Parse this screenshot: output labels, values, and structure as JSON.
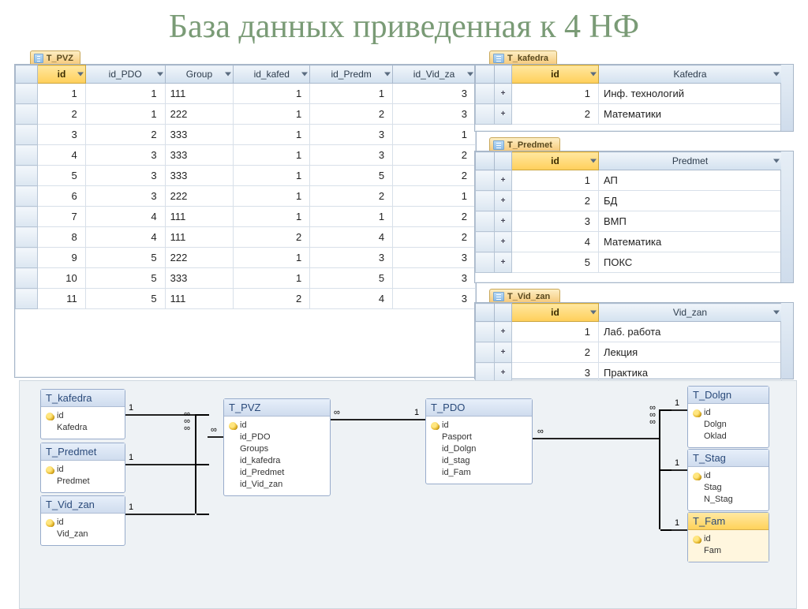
{
  "title": "База данных приведенная к 4 НФ",
  "tables": {
    "t_pvz": {
      "tab": "T_PVZ",
      "columns": [
        "id",
        "id_PDO",
        "Group",
        "id_kafed",
        "id_Predm",
        "id_Vid_za"
      ],
      "rows": [
        {
          "id": 1,
          "id_PDO": 1,
          "Group": "111",
          "id_kafed": 1,
          "id_Predm": 1,
          "id_Vid_za": 3
        },
        {
          "id": 2,
          "id_PDO": 1,
          "Group": "222",
          "id_kafed": 1,
          "id_Predm": 2,
          "id_Vid_za": 3
        },
        {
          "id": 3,
          "id_PDO": 2,
          "Group": "333",
          "id_kafed": 1,
          "id_Predm": 3,
          "id_Vid_za": 1
        },
        {
          "id": 4,
          "id_PDO": 3,
          "Group": "333",
          "id_kafed": 1,
          "id_Predm": 3,
          "id_Vid_za": 2
        },
        {
          "id": 5,
          "id_PDO": 3,
          "Group": "333",
          "id_kafed": 1,
          "id_Predm": 5,
          "id_Vid_za": 2
        },
        {
          "id": 6,
          "id_PDO": 3,
          "Group": "222",
          "id_kafed": 1,
          "id_Predm": 2,
          "id_Vid_za": 1
        },
        {
          "id": 7,
          "id_PDO": 4,
          "Group": "111",
          "id_kafed": 1,
          "id_Predm": 1,
          "id_Vid_za": 2
        },
        {
          "id": 8,
          "id_PDO": 4,
          "Group": "111",
          "id_kafed": 2,
          "id_Predm": 4,
          "id_Vid_za": 2
        },
        {
          "id": 9,
          "id_PDO": 5,
          "Group": "222",
          "id_kafed": 1,
          "id_Predm": 3,
          "id_Vid_za": 3
        },
        {
          "id": 10,
          "id_PDO": 5,
          "Group": "333",
          "id_kafed": 1,
          "id_Predm": 5,
          "id_Vid_za": 3
        },
        {
          "id": 11,
          "id_PDO": 5,
          "Group": "111",
          "id_kafed": 2,
          "id_Predm": 4,
          "id_Vid_za": 3
        }
      ]
    },
    "t_kafedra": {
      "tab": "T_kafedra",
      "columns": [
        "id",
        "Kafedra"
      ],
      "rows": [
        {
          "id": 1,
          "Kafedra": "Инф. технологий"
        },
        {
          "id": 2,
          "Kafedra": "Математики"
        }
      ]
    },
    "t_predmet": {
      "tab": "T_Predmet",
      "columns": [
        "id",
        "Predmet"
      ],
      "rows": [
        {
          "id": 1,
          "Predmet": "АП"
        },
        {
          "id": 2,
          "Predmet": "БД"
        },
        {
          "id": 3,
          "Predmet": "ВМП"
        },
        {
          "id": 4,
          "Predmet": "Математика"
        },
        {
          "id": 5,
          "Predmet": "ПОКС"
        }
      ]
    },
    "t_vid_zan": {
      "tab": "T_Vid_zan",
      "columns": [
        "id",
        "Vid_zan"
      ],
      "rows": [
        {
          "id": 1,
          "Vid_zan": "Лаб. работа"
        },
        {
          "id": 2,
          "Vid_zan": "Лекция"
        },
        {
          "id": 3,
          "Vid_zan": "Практика"
        }
      ]
    }
  },
  "diagram": {
    "boxes": {
      "t_kafedra": {
        "title": "T_kafedra",
        "fields": [
          {
            "n": "id",
            "pk": true
          },
          {
            "n": "Kafedra"
          }
        ]
      },
      "t_predmet": {
        "title": "T_Predmet",
        "fields": [
          {
            "n": "id",
            "pk": true
          },
          {
            "n": "Predmet"
          }
        ]
      },
      "t_vid_zan": {
        "title": "T_Vid_zan",
        "fields": [
          {
            "n": "id",
            "pk": true
          },
          {
            "n": "Vid_zan"
          }
        ]
      },
      "t_pvz": {
        "title": "T_PVZ",
        "fields": [
          {
            "n": "id",
            "pk": true
          },
          {
            "n": "id_PDO"
          },
          {
            "n": "Groups"
          },
          {
            "n": "id_kafedra"
          },
          {
            "n": "id_Predmet"
          },
          {
            "n": "id_Vid_zan"
          }
        ]
      },
      "t_pdo": {
        "title": "T_PDO",
        "fields": [
          {
            "n": "id",
            "pk": true
          },
          {
            "n": "Pasport"
          },
          {
            "n": "id_Dolgn"
          },
          {
            "n": "id_stag"
          },
          {
            "n": "id_Fam"
          }
        ]
      },
      "t_dolgn": {
        "title": "T_Dolgn",
        "fields": [
          {
            "n": "id",
            "pk": true
          },
          {
            "n": "Dolgn"
          },
          {
            "n": "Oklad"
          }
        ]
      },
      "t_stag": {
        "title": "T_Stag",
        "fields": [
          {
            "n": "id",
            "pk": true
          },
          {
            "n": "Stag"
          },
          {
            "n": "N_Stag"
          }
        ]
      },
      "t_fam": {
        "title": "T_Fam",
        "fields": [
          {
            "n": "id",
            "pk": true
          },
          {
            "n": "Fam"
          }
        ]
      }
    },
    "link_labels": {
      "one": "1",
      "many": "∞"
    }
  }
}
